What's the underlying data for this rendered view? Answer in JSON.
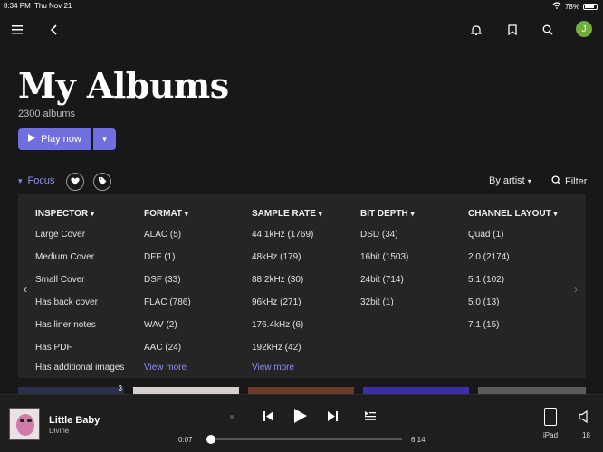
{
  "status": {
    "time": "8:34 PM",
    "date": "Thu Nov 21",
    "battery": "78%"
  },
  "header": {
    "avatar_letter": "J"
  },
  "page": {
    "title": "My Albums",
    "count": "2300 albums"
  },
  "actions": {
    "play_label": "Play now"
  },
  "toolbar": {
    "focus_label": "Focus",
    "sort_label": "By artist",
    "filter_label": "Filter"
  },
  "inspector": {
    "columns": [
      {
        "header": "INSPECTOR",
        "items": [
          "Large Cover",
          "Medium Cover",
          "Small Cover",
          "Has back cover",
          "Has liner notes",
          "Has PDF",
          "Has additional images"
        ]
      },
      {
        "header": "FORMAT",
        "items": [
          "ALAC (5)",
          "DFF (1)",
          "DSF (33)",
          "FLAC (786)",
          "WAV (2)",
          "AAC (24)"
        ],
        "more": "View more"
      },
      {
        "header": "SAMPLE RATE",
        "items": [
          "44.1kHz (1769)",
          "48kHz (179)",
          "88.2kHz (30)",
          "96kHz (271)",
          "176.4kHz (6)",
          "192kHz (42)"
        ],
        "more": "View more"
      },
      {
        "header": "BIT DEPTH",
        "items": [
          "DSD (34)",
          "16bit (1503)",
          "24bit (714)",
          "32bit (1)"
        ]
      },
      {
        "header": "CHANNEL LAYOUT",
        "items": [
          "Quad (1)",
          "2.0 (2174)",
          "5.1 (102)",
          "5.0 (13)",
          "7.1 (15)"
        ]
      }
    ]
  },
  "thumb_badge": "3",
  "player": {
    "title": "Little Baby",
    "artist": "Divine",
    "elapsed": "0:07",
    "duration": "6:14",
    "progress": 0.019,
    "device": "iPad",
    "volume": "18"
  },
  "colors": {
    "accent": "#6f6fe0",
    "link": "#8f8ff2",
    "background": "#181818",
    "panel": "#252525"
  }
}
